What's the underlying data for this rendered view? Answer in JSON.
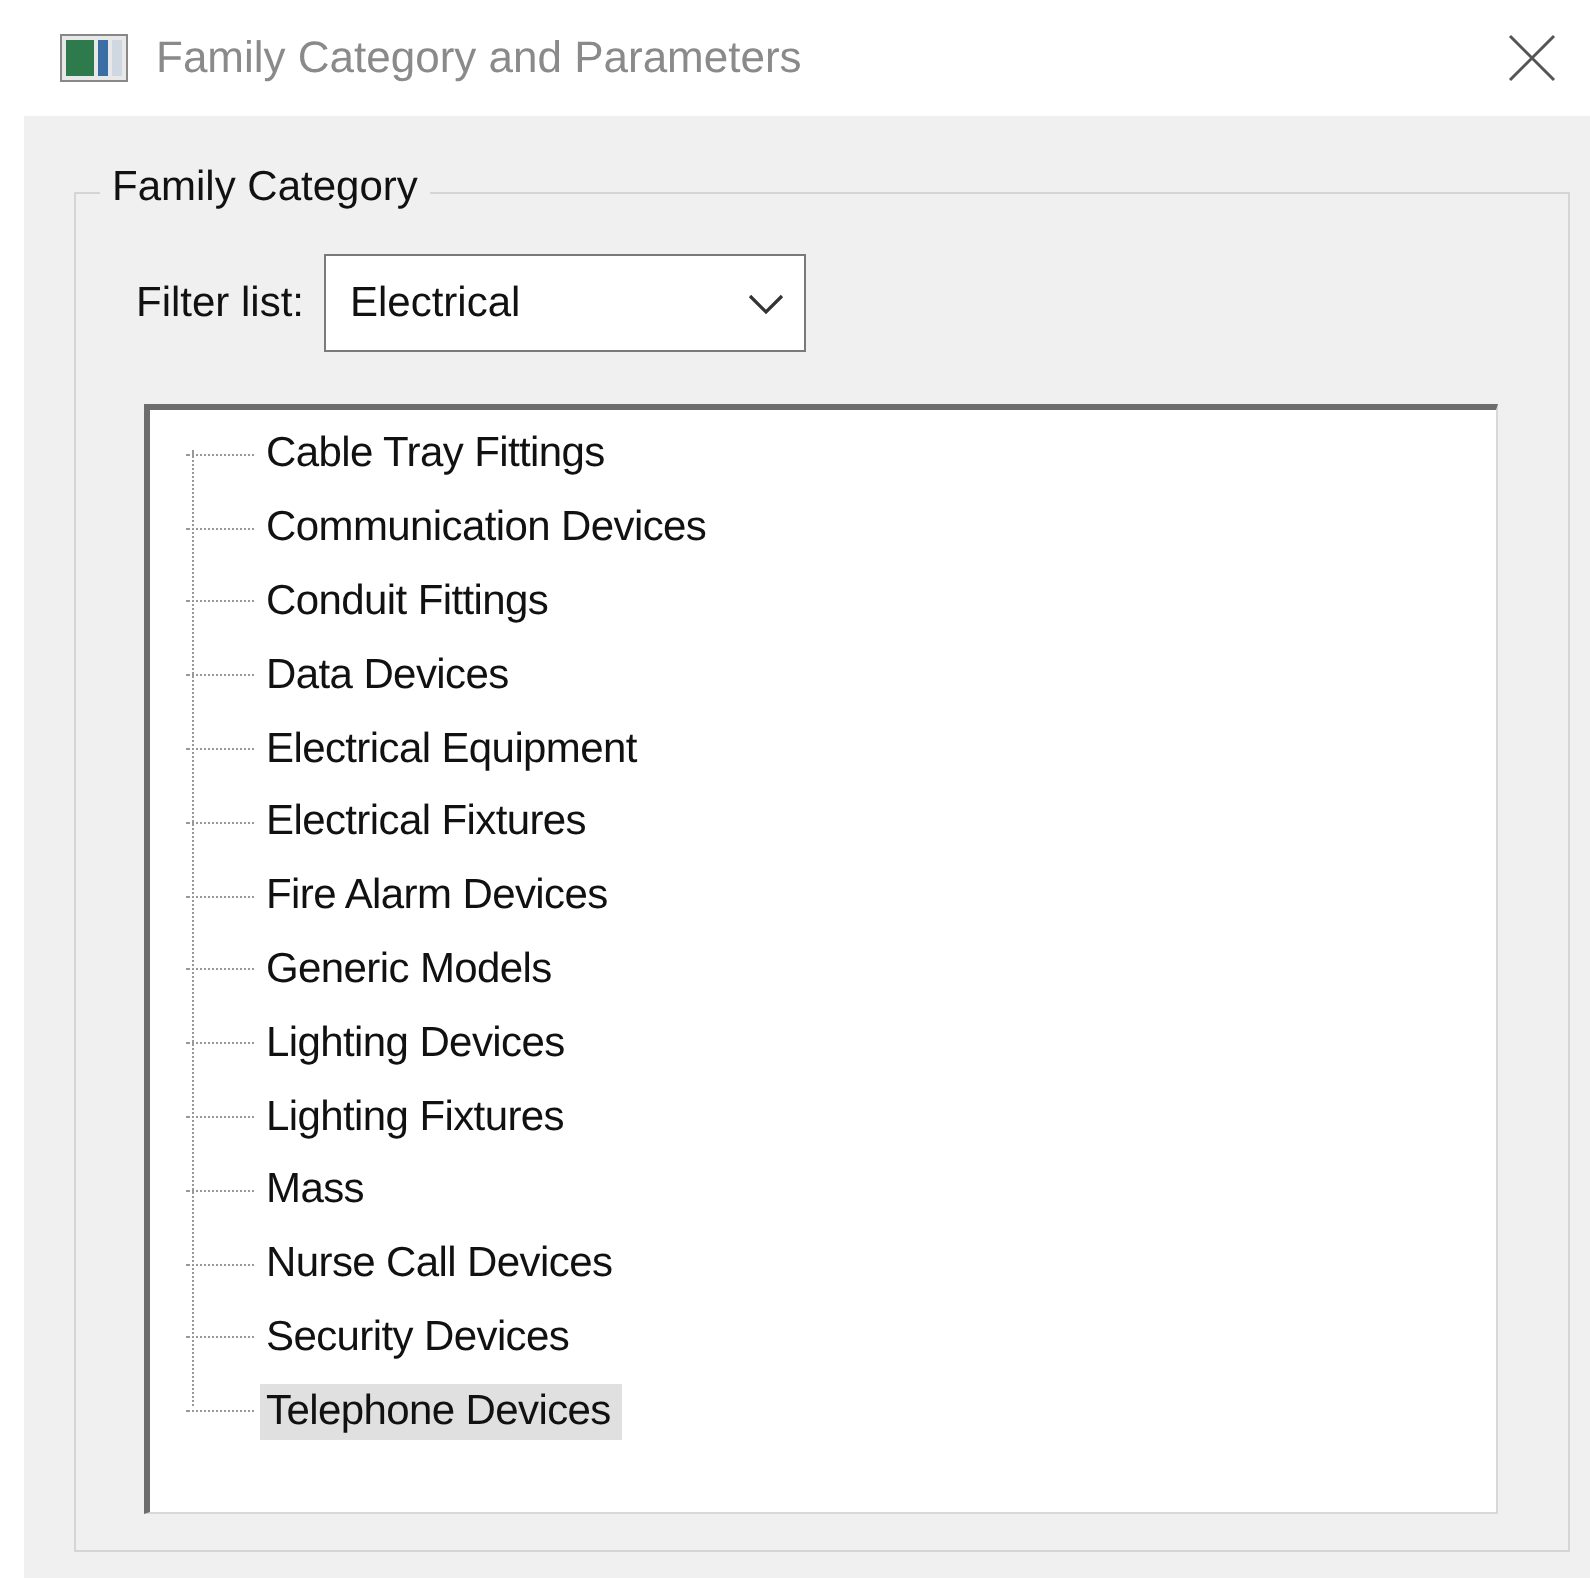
{
  "window": {
    "title": "Family Category and Parameters"
  },
  "group": {
    "title": "Family Category"
  },
  "filter": {
    "label": "Filter list:",
    "value": "Electrical"
  },
  "tree": {
    "items": [
      {
        "label": "Cable Tray Fittings",
        "selected": false
      },
      {
        "label": "Communication Devices",
        "selected": false
      },
      {
        "label": "Conduit Fittings",
        "selected": false
      },
      {
        "label": "Data Devices",
        "selected": false
      },
      {
        "label": "Electrical Equipment",
        "selected": false
      },
      {
        "label": "Electrical Fixtures",
        "selected": false
      },
      {
        "label": "Fire Alarm Devices",
        "selected": false
      },
      {
        "label": "Generic Models",
        "selected": false
      },
      {
        "label": "Lighting Devices",
        "selected": false
      },
      {
        "label": "Lighting Fixtures",
        "selected": false
      },
      {
        "label": "Mass",
        "selected": false
      },
      {
        "label": "Nurse Call Devices",
        "selected": false
      },
      {
        "label": "Security Devices",
        "selected": false
      },
      {
        "label": "Telephone Devices",
        "selected": true
      }
    ]
  }
}
